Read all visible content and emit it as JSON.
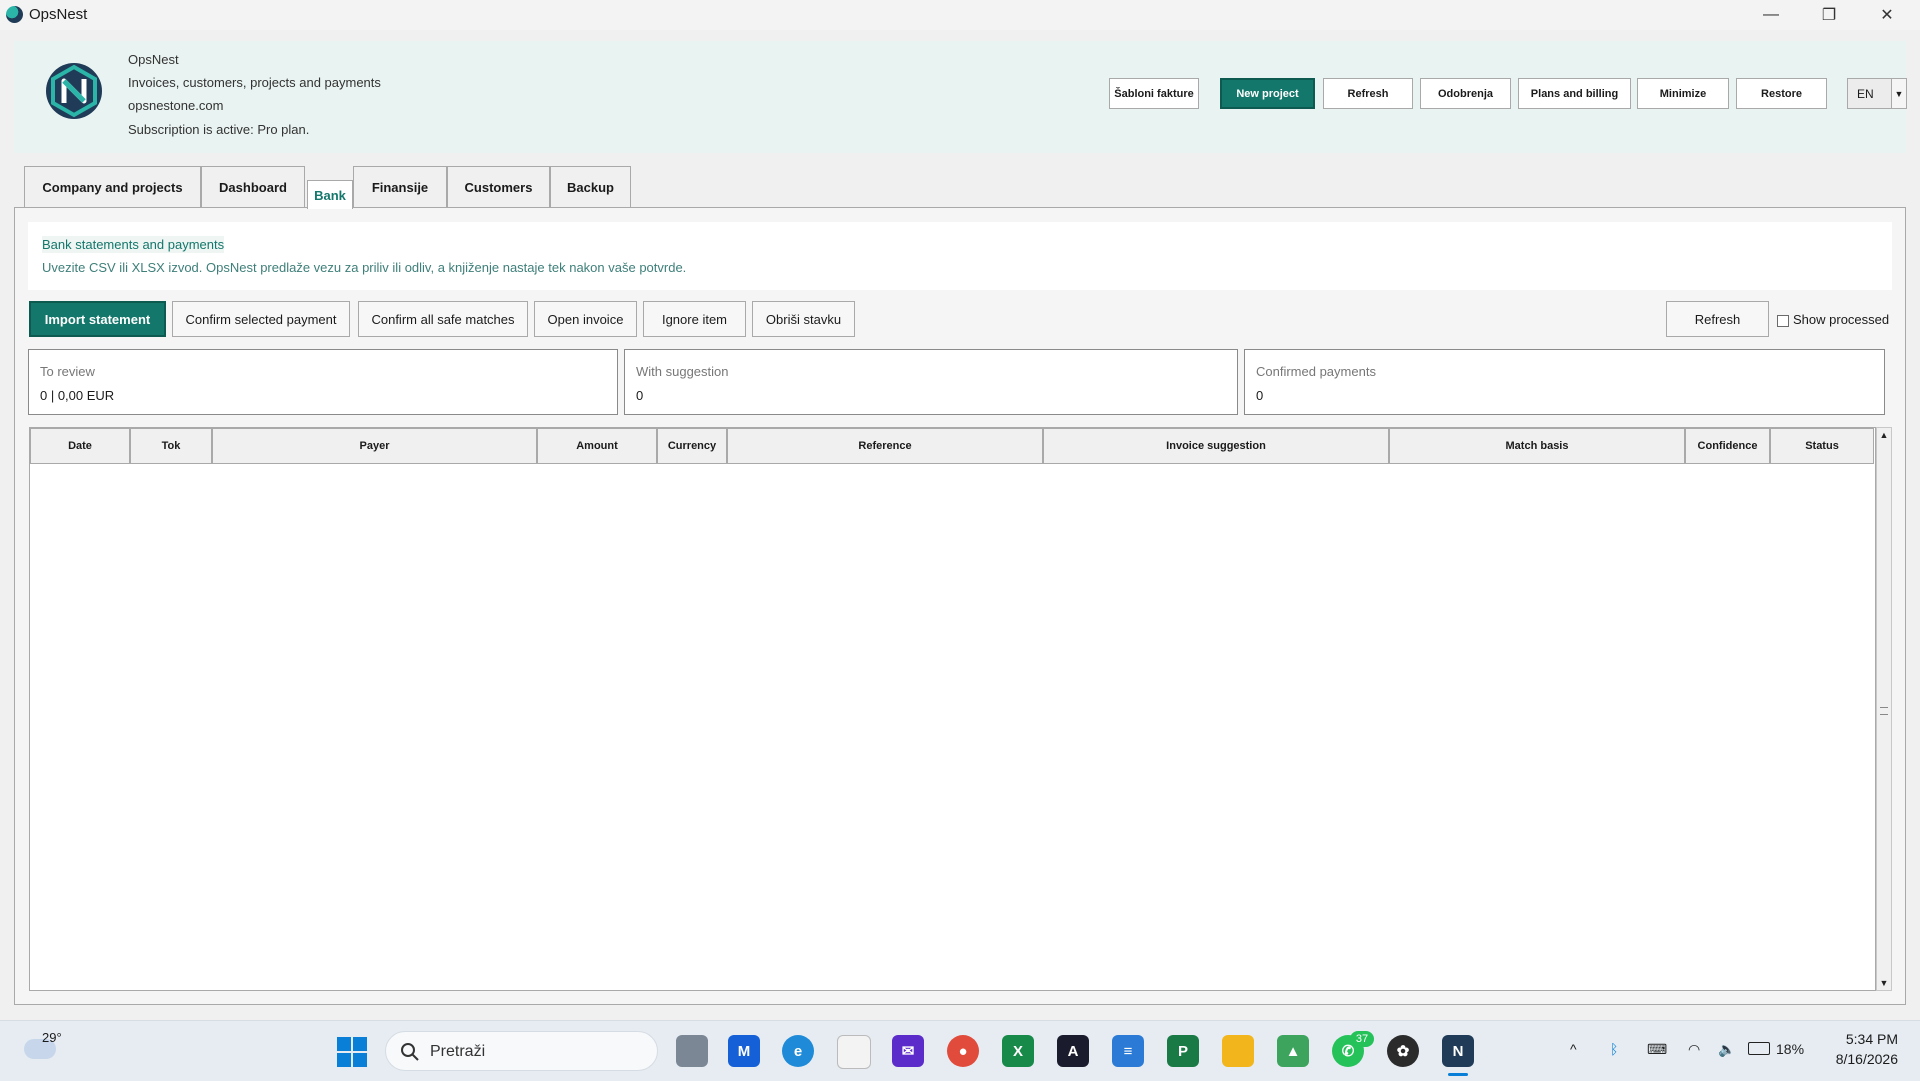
{
  "window": {
    "title": "OpsNest",
    "controls": {
      "minimize": "—",
      "restore": "❐",
      "close": "✕"
    }
  },
  "header": {
    "app_name": "OpsNest",
    "tagline": "Invoices, customers, projects and payments",
    "website": "opsnestone.com",
    "subscription": "Subscription is active: Pro plan.",
    "buttons": [
      "Šabloni fakture",
      "New project",
      "Refresh",
      "Odobrenja",
      "Plans and billing",
      "Minimize",
      "Restore"
    ],
    "language": "EN",
    "brand_color": "#14776b"
  },
  "tabs": [
    "Company and projects",
    "Dashboard",
    "Bank",
    "Finansije",
    "Customers",
    "Backup"
  ],
  "active_tab": "Bank",
  "bank": {
    "title": "Bank statements and payments",
    "description": "Uvezite CSV ili XLSX izvod. OpsNest predlaže vezu za priliv ili odliv, a knjiženje nastaje tek nakon vaše potvrde.",
    "actions": [
      "Import statement",
      "Confirm selected payment",
      "Confirm all safe matches",
      "Open invoice",
      "Ignore item",
      "Obriši stavku"
    ],
    "refresh_label": "Refresh",
    "show_processed_label": "Show processed",
    "show_processed": false,
    "summary": [
      {
        "label": "To review",
        "value": "0 | 0,00 EUR"
      },
      {
        "label": "With suggestion",
        "value": "0"
      },
      {
        "label": "Confirmed payments",
        "value": "0"
      }
    ],
    "table_columns": [
      "Date",
      "Tok",
      "Payer",
      "Amount",
      "Currency",
      "Reference",
      "Invoice suggestion",
      "Match basis",
      "Confidence",
      "Status"
    ],
    "rows": []
  },
  "taskbar": {
    "weather_temp": "29°",
    "search_placeholder": "Pretraži",
    "apps": [
      "task-view",
      "app-ms",
      "edge",
      "store",
      "mail",
      "chrome",
      "excel-x",
      "affinity",
      "notepad",
      "project",
      "explorer",
      "photos",
      "whatsapp",
      "chatgpt",
      "opsnest"
    ],
    "whatsapp_badge": "37",
    "battery": "18%",
    "time": "5:34 PM",
    "date": "8/16/2026"
  }
}
